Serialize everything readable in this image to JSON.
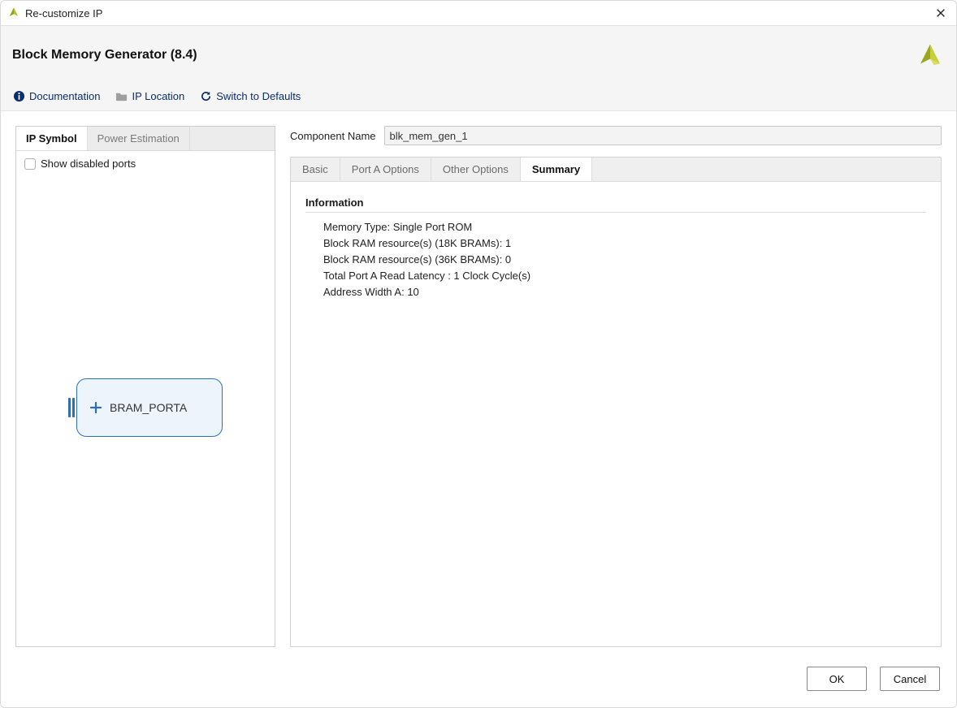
{
  "window": {
    "title": "Re-customize IP"
  },
  "header": {
    "title": "Block Memory Generator (8.4)",
    "toolbar": {
      "documentation": "Documentation",
      "ip_location": "IP Location",
      "switch_defaults": "Switch to Defaults"
    }
  },
  "left": {
    "tabs": {
      "ip_symbol": "IP Symbol",
      "power_estimation": "Power Estimation"
    },
    "show_disabled_ports": "Show disabled ports",
    "symbol": {
      "port_label": "BRAM_PORTA"
    }
  },
  "right": {
    "component_name_label": "Component Name",
    "component_name_value": "blk_mem_gen_1",
    "tabs": {
      "basic": "Basic",
      "port_a_options": "Port A Options",
      "other_options": "Other Options",
      "summary": "Summary"
    },
    "summary": {
      "section_title": "Information",
      "lines": {
        "l0": "Memory Type: Single Port ROM",
        "l1": "Block RAM resource(s) (18K BRAMs): 1",
        "l2": "Block RAM resource(s) (36K BRAMs): 0",
        "l3": "Total Port A Read Latency : 1 Clock Cycle(s)",
        "l4": "Address Width A: 10"
      }
    }
  },
  "footer": {
    "ok": "OK",
    "cancel": "Cancel"
  }
}
